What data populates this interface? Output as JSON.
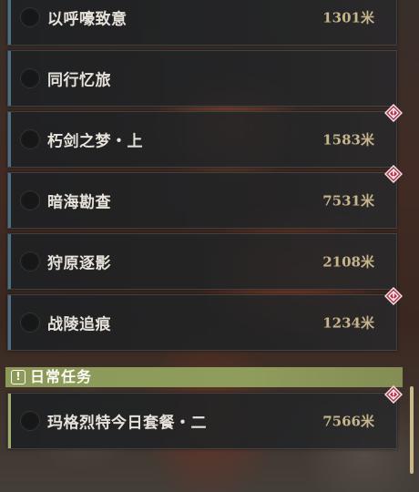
{
  "quests": [
    {
      "title": "以呼嚎致意",
      "distance": "1301米",
      "alert": true
    },
    {
      "title": "同行忆旅",
      "distance": "",
      "alert": false
    },
    {
      "title": "朽剑之梦・上",
      "distance": "1583米",
      "alert": true
    },
    {
      "title": "暗海勘查",
      "distance": "7531米",
      "alert": true
    },
    {
      "title": "狩原逐影",
      "distance": "2108米",
      "alert": false
    },
    {
      "title": "战陵追痕",
      "distance": "1234米",
      "alert": true
    }
  ],
  "daily_section": {
    "badge": "!",
    "label": "日常任务",
    "color": "#8b9a58"
  },
  "daily_quests": [
    {
      "title": "玛格烈特今日套餐・二",
      "distance": "7566米",
      "alert": true
    }
  ],
  "colors": {
    "accent_blue": "#4d6f86",
    "accent_green": "#9eae6a",
    "alert_red": "#b8304a",
    "distance_text": "#c7b58c"
  },
  "icons": {
    "alert": "alert-diamond-icon",
    "status": "status-ring-icon"
  }
}
